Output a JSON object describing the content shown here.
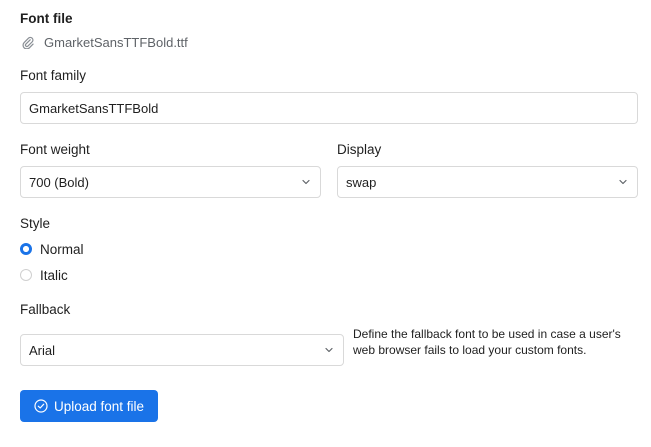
{
  "font_file": {
    "label": "Font file",
    "filename": "GmarketSansTTFBold.ttf",
    "icon": "paperclip-icon"
  },
  "font_family": {
    "label": "Font family",
    "value": "GmarketSansTTFBold"
  },
  "font_weight": {
    "label": "Font weight",
    "selected": "700 (Bold)"
  },
  "display": {
    "label": "Display",
    "selected": "swap"
  },
  "style": {
    "label": "Style",
    "options": [
      {
        "label": "Normal",
        "checked": true
      },
      {
        "label": "Italic",
        "checked": false
      }
    ]
  },
  "fallback": {
    "label": "Fallback",
    "selected": "Arial",
    "help": "Define the fallback font to be used in case a user's web browser fails to load your custom fonts."
  },
  "upload_button": {
    "label": "Upload font file",
    "icon": "check-circle-icon"
  },
  "colors": {
    "accent": "#1a73e8",
    "border": "#d9d9d9",
    "text": "#1f1f1f",
    "muted": "#5f6368"
  }
}
